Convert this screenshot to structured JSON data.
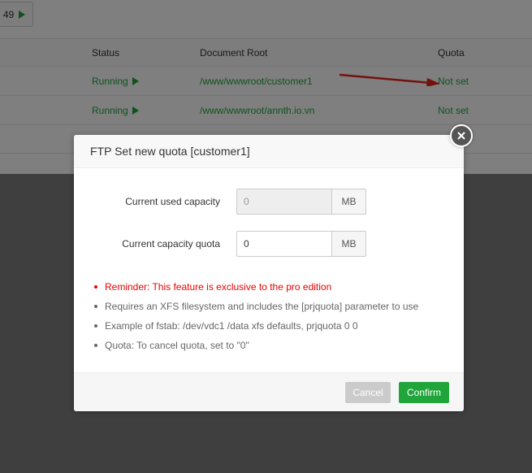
{
  "pager": {
    "label": "49"
  },
  "table": {
    "headers": {
      "status": "Status",
      "root": "Document Root",
      "quota": "Quota"
    },
    "rows": [
      {
        "status": "Running",
        "root": "/www/wwwroot/customer1",
        "quota": "Not set"
      },
      {
        "status": "Running",
        "root": "/www/wwwroot/annth.io.vn",
        "quota": "Not set"
      }
    ]
  },
  "dialog": {
    "title": "FTP Set new quota [customer1]",
    "used": {
      "label": "Current used capacity",
      "value": "0",
      "unit": "MB"
    },
    "quota": {
      "label": "Current capacity quota",
      "value": "0",
      "unit": "MB"
    },
    "notes": [
      "Reminder: This feature is exclusive to the pro edition",
      "Requires an XFS filesystem and includes the [prjquota] parameter to use",
      "Example of fstab: /dev/vdc1 /data xfs defaults, prjquota 0 0",
      "Quota: To cancel quota, set to \"0\""
    ],
    "cancel_label": "Cancel",
    "confirm_label": "Confirm"
  },
  "colors": {
    "accent": "#20a53a",
    "warning": "#ee0000",
    "annotation_arrow": "#e8231f"
  }
}
